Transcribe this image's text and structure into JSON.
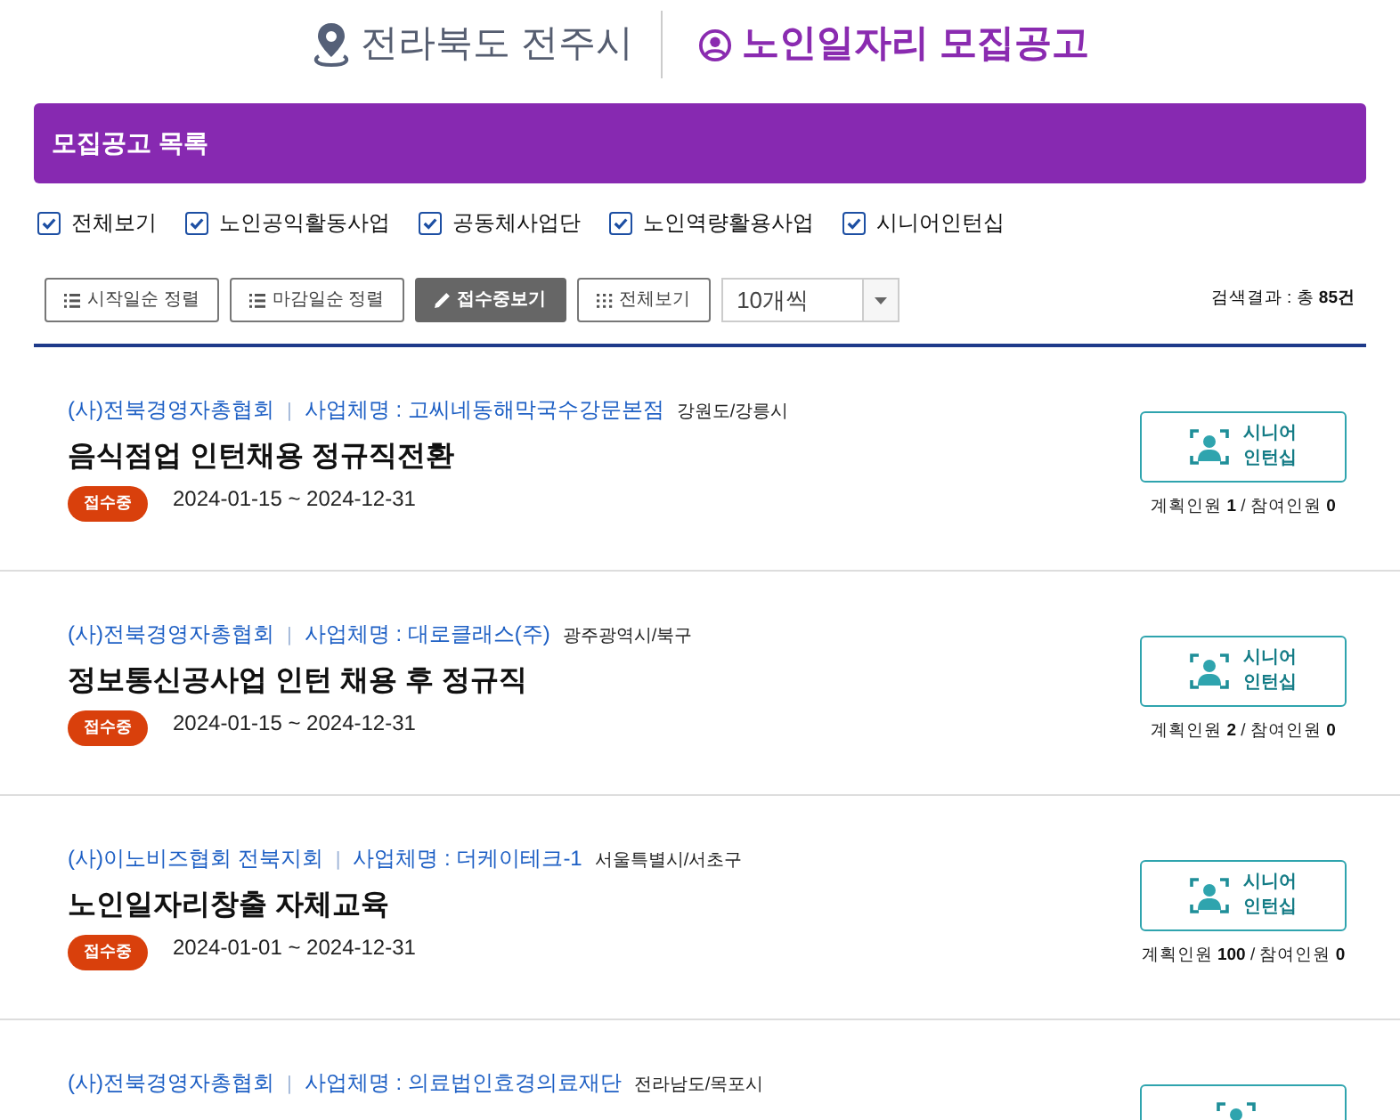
{
  "header": {
    "region": "전라북도 전주시",
    "title": "노인일자리 모집공고"
  },
  "panel": {
    "title": "모집공고 목록"
  },
  "filters": [
    {
      "label": "전체보기",
      "checked": true
    },
    {
      "label": "노인공익활동사업",
      "checked": true
    },
    {
      "label": "공동체사업단",
      "checked": true
    },
    {
      "label": "노인역량활용사업",
      "checked": true
    },
    {
      "label": "시니어인턴십",
      "checked": true
    }
  ],
  "toolbar": {
    "buttons": [
      {
        "label": "시작일순 정렬",
        "kind": "list",
        "selected": false
      },
      {
        "label": "마감일순 정렬",
        "kind": "list",
        "selected": false
      },
      {
        "label": "접수중보기",
        "kind": "pencil",
        "selected": true
      },
      {
        "label": "전체보기",
        "kind": "grid",
        "selected": false
      }
    ],
    "page_size": "10개씩",
    "result_label": "검색결과 : 총",
    "result_count": "85건"
  },
  "postings": [
    {
      "org": "(사)전북경영자총협회",
      "separator": "|",
      "company": "사업체명 : 고씨네동해막국수강문본점",
      "location": "강원도/강릉시",
      "title": "음식점업 인턴채용 정규직전환",
      "status": "접수중",
      "period": "2024-01-15 ~ 2024-12-31",
      "type_line1": "시니어",
      "type_line2": "인턴십",
      "planned_label": "계획인원",
      "planned": "1",
      "joined_label": "/ 참여인원",
      "joined": "0"
    },
    {
      "org": "(사)전북경영자총협회",
      "separator": "|",
      "company": "사업체명 : 대로클래스(주)",
      "location": "광주광역시/북구",
      "title": "정보통신공사업 인턴 채용 후 정규직",
      "status": "접수중",
      "period": "2024-01-15 ~ 2024-12-31",
      "type_line1": "시니어",
      "type_line2": "인턴십",
      "planned_label": "계획인원",
      "planned": "2",
      "joined_label": "/ 참여인원",
      "joined": "0"
    },
    {
      "org": "(사)이노비즈협회 전북지회",
      "separator": "|",
      "company": "사업체명 : 더케이테크-1",
      "location": "서울특별시/서초구",
      "title": "노인일자리창출 자체교육",
      "status": "접수중",
      "period": "2024-01-01 ~ 2024-12-31",
      "type_line1": "시니어",
      "type_line2": "인턴십",
      "planned_label": "계획인원",
      "planned": "100",
      "joined_label": "/ 참여인원",
      "joined": "0"
    },
    {
      "org": "(사)전북경영자총협회",
      "separator": "|",
      "company": "사업체명 : 의료법인효경의료재단",
      "location": "전라남도/목포시"
    }
  ]
}
